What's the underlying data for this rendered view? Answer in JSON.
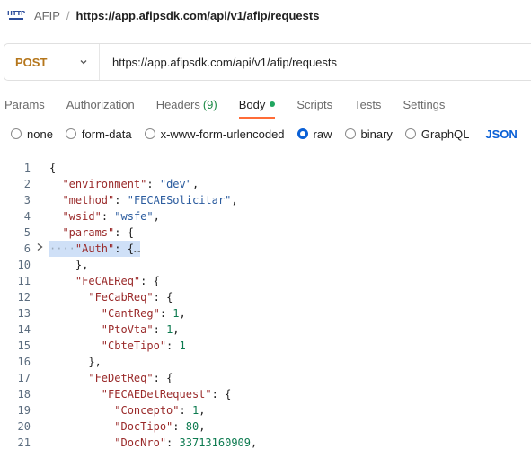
{
  "breadcrumb": {
    "parent": "AFIP",
    "separator": "/",
    "current": "https://app.afipsdk.com/api/v1/afip/requests",
    "icon": "http-request-icon"
  },
  "request": {
    "method": "POST",
    "url": "https://app.afipsdk.com/api/v1/afip/requests"
  },
  "tabs": [
    {
      "label": "Params"
    },
    {
      "label": "Authorization"
    },
    {
      "label": "Headers",
      "count": "(9)"
    },
    {
      "label": "Body",
      "active": true
    },
    {
      "label": "Scripts"
    },
    {
      "label": "Tests"
    },
    {
      "label": "Settings"
    }
  ],
  "body_types": {
    "options": [
      "none",
      "form-data",
      "x-www-form-urlencoded",
      "raw",
      "binary",
      "GraphQL"
    ],
    "selected": "raw",
    "format": "JSON"
  },
  "editor": {
    "lines": [
      {
        "n": "1",
        "text": "{"
      },
      {
        "n": "2",
        "text": "  \"environment\": \"dev\","
      },
      {
        "n": "3",
        "text": "  \"method\": \"FECAESolicitar\","
      },
      {
        "n": "4",
        "text": "  \"wsid\": \"wsfe\","
      },
      {
        "n": "5",
        "text": "  \"params\": {"
      },
      {
        "n": "6",
        "text": "    \"Auth\": {…",
        "folded": true,
        "highlighted": true
      },
      {
        "n": "10",
        "text": "    },"
      },
      {
        "n": "11",
        "text": "    \"FeCAEReq\": {"
      },
      {
        "n": "12",
        "text": "      \"FeCabReq\": {"
      },
      {
        "n": "13",
        "text": "        \"CantReg\": 1,"
      },
      {
        "n": "14",
        "text": "        \"PtoVta\": 1,"
      },
      {
        "n": "15",
        "text": "        \"CbteTipo\": 1"
      },
      {
        "n": "16",
        "text": "      },"
      },
      {
        "n": "17",
        "text": "      \"FeDetReq\": {"
      },
      {
        "n": "18",
        "text": "        \"FECAEDetRequest\": {"
      },
      {
        "n": "19",
        "text": "          \"Concepto\": 1,"
      },
      {
        "n": "20",
        "text": "          \"DocTipo\": 80,"
      },
      {
        "n": "21",
        "text": "          \"DocNro\": 33713160909,"
      }
    ]
  },
  "colors": {
    "method": "#b5761b",
    "accent": "#ff6c37",
    "link": "#0a60d6",
    "ok": "#20a660"
  }
}
